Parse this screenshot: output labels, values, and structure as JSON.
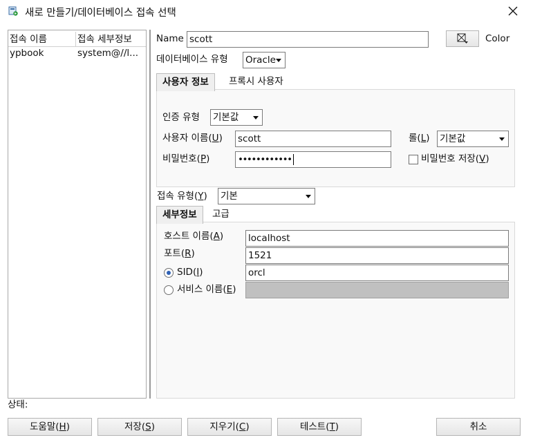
{
  "window": {
    "title": "새로 만들기/데이터베이스 접속 선택"
  },
  "conn_list": {
    "headers": [
      "접속 이름",
      "접속 세부정보"
    ],
    "rows": [
      {
        "name": "ypbook",
        "detail": "system@//l..."
      }
    ]
  },
  "form": {
    "name_label": "Name",
    "name_value": "scott",
    "color_label": "Color",
    "db_type_label": "데이터베이스 유형",
    "db_type_value": "Oracle",
    "tabs": [
      "사용자 정보",
      "프록시 사용자"
    ],
    "auth_type_label": "인증 유형",
    "auth_type_value": "기본값",
    "user_label": "사용자 이름(",
    "user_key": "U",
    "user_value": "scott",
    "role_label": "롤(",
    "role_key": "L",
    "role_value": "기본값",
    "pw_label": "비밀번호(",
    "pw_key": "P",
    "pw_value": "••••••••••••",
    "save_pw_label": "비밀번호 저장(",
    "save_pw_key": "V",
    "conn_type_label": "접속 유형(",
    "conn_type_key": "Y",
    "conn_type_value": "기본",
    "detail_tabs": [
      "세부정보",
      "고급"
    ],
    "host_label": "호스트 이름(",
    "host_key": "A",
    "host_value": "localhost",
    "port_label": "포트(",
    "port_key": "R",
    "port_value": "1521",
    "sid_label": "SID(",
    "sid_key": "I",
    "sid_value": "orcl",
    "service_label": "서비스 이름(",
    "service_key": "E"
  },
  "status": {
    "label": "상태:"
  },
  "buttons": {
    "help": "도움말(",
    "help_key": "H",
    "save": "저장(",
    "save_key": "S",
    "clear": "지우기(",
    "clear_key": "C",
    "test": "테스트(",
    "test_key": "T",
    "cancel": "취소"
  },
  "icons": {
    "app": "db-connection-icon",
    "close": "close-icon",
    "color": "color-picker-icon"
  }
}
